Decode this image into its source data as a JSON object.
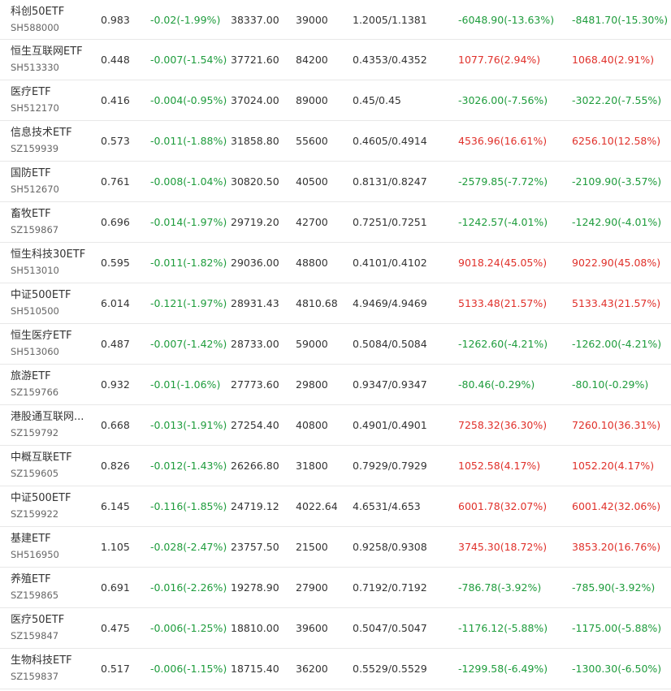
{
  "colors": {
    "up": "#e0302a",
    "down": "#1e9c3c",
    "text": "#333333",
    "subtext": "#666666",
    "divider": "#e8e8e8"
  },
  "rows": [
    {
      "name": "科创50ETF",
      "code": "SH588000",
      "price": "0.983",
      "change": "-0.02(-1.99%)",
      "turnover": "38337.00",
      "volume": "39000",
      "bidask": "1.2005/1.1381",
      "flow1": "-6048.90(-13.63%)",
      "flow1_dir": "down",
      "flow2": "-8481.70(-15.30%)",
      "flow2_dir": "down"
    },
    {
      "name": "恒生互联网ETF",
      "code": "SH513330",
      "price": "0.448",
      "change": "-0.007(-1.54%)",
      "turnover": "37721.60",
      "volume": "84200",
      "bidask": "0.4353/0.4352",
      "flow1": "1077.76(2.94%)",
      "flow1_dir": "up",
      "flow2": "1068.40(2.91%)",
      "flow2_dir": "up"
    },
    {
      "name": "医疗ETF",
      "code": "SH512170",
      "price": "0.416",
      "change": "-0.004(-0.95%)",
      "turnover": "37024.00",
      "volume": "89000",
      "bidask": "0.45/0.45",
      "flow1": "-3026.00(-7.56%)",
      "flow1_dir": "down",
      "flow2": "-3022.20(-7.55%)",
      "flow2_dir": "down"
    },
    {
      "name": "信息技术ETF",
      "code": "SZ159939",
      "price": "0.573",
      "change": "-0.011(-1.88%)",
      "turnover": "31858.80",
      "volume": "55600",
      "bidask": "0.4605/0.4914",
      "flow1": "4536.96(16.61%)",
      "flow1_dir": "up",
      "flow2": "6256.10(12.58%)",
      "flow2_dir": "up"
    },
    {
      "name": "国防ETF",
      "code": "SH512670",
      "price": "0.761",
      "change": "-0.008(-1.04%)",
      "turnover": "30820.50",
      "volume": "40500",
      "bidask": "0.8131/0.8247",
      "flow1": "-2579.85(-7.72%)",
      "flow1_dir": "down",
      "flow2": "-2109.90(-3.57%)",
      "flow2_dir": "down"
    },
    {
      "name": "畜牧ETF",
      "code": "SZ159867",
      "price": "0.696",
      "change": "-0.014(-1.97%)",
      "turnover": "29719.20",
      "volume": "42700",
      "bidask": "0.7251/0.7251",
      "flow1": "-1242.57(-4.01%)",
      "flow1_dir": "down",
      "flow2": "-1242.90(-4.01%)",
      "flow2_dir": "down"
    },
    {
      "name": "恒生科技30ETF",
      "code": "SH513010",
      "price": "0.595",
      "change": "-0.011(-1.82%)",
      "turnover": "29036.00",
      "volume": "48800",
      "bidask": "0.4101/0.4102",
      "flow1": "9018.24(45.05%)",
      "flow1_dir": "up",
      "flow2": "9022.90(45.08%)",
      "flow2_dir": "up"
    },
    {
      "name": "中证500ETF",
      "code": "SH510500",
      "price": "6.014",
      "change": "-0.121(-1.97%)",
      "turnover": "28931.43",
      "volume": "4810.68",
      "bidask": "4.9469/4.9469",
      "flow1": "5133.48(21.57%)",
      "flow1_dir": "up",
      "flow2": "5133.43(21.57%)",
      "flow2_dir": "up"
    },
    {
      "name": "恒生医疗ETF",
      "code": "SH513060",
      "price": "0.487",
      "change": "-0.007(-1.42%)",
      "turnover": "28733.00",
      "volume": "59000",
      "bidask": "0.5084/0.5084",
      "flow1": "-1262.60(-4.21%)",
      "flow1_dir": "down",
      "flow2": "-1262.00(-4.21%)",
      "flow2_dir": "down"
    },
    {
      "name": "旅游ETF",
      "code": "SZ159766",
      "price": "0.932",
      "change": "-0.01(-1.06%)",
      "turnover": "27773.60",
      "volume": "29800",
      "bidask": "0.9347/0.9347",
      "flow1": "-80.46(-0.29%)",
      "flow1_dir": "down",
      "flow2": "-80.10(-0.29%)",
      "flow2_dir": "down"
    },
    {
      "name": "港股通互联网...",
      "code": "SZ159792",
      "price": "0.668",
      "change": "-0.013(-1.91%)",
      "turnover": "27254.40",
      "volume": "40800",
      "bidask": "0.4901/0.4901",
      "flow1": "7258.32(36.30%)",
      "flow1_dir": "up",
      "flow2": "7260.10(36.31%)",
      "flow2_dir": "up"
    },
    {
      "name": "中概互联ETF",
      "code": "SZ159605",
      "price": "0.826",
      "change": "-0.012(-1.43%)",
      "turnover": "26266.80",
      "volume": "31800",
      "bidask": "0.7929/0.7929",
      "flow1": "1052.58(4.17%)",
      "flow1_dir": "up",
      "flow2": "1052.20(4.17%)",
      "flow2_dir": "up"
    },
    {
      "name": "中证500ETF",
      "code": "SZ159922",
      "price": "6.145",
      "change": "-0.116(-1.85%)",
      "turnover": "24719.12",
      "volume": "4022.64",
      "bidask": "4.6531/4.653",
      "flow1": "6001.78(32.07%)",
      "flow1_dir": "up",
      "flow2": "6001.42(32.06%)",
      "flow2_dir": "up"
    },
    {
      "name": "基建ETF",
      "code": "SH516950",
      "price": "1.105",
      "change": "-0.028(-2.47%)",
      "turnover": "23757.50",
      "volume": "21500",
      "bidask": "0.9258/0.9308",
      "flow1": "3745.30(18.72%)",
      "flow1_dir": "up",
      "flow2": "3853.20(16.76%)",
      "flow2_dir": "up"
    },
    {
      "name": "养殖ETF",
      "code": "SZ159865",
      "price": "0.691",
      "change": "-0.016(-2.26%)",
      "turnover": "19278.90",
      "volume": "27900",
      "bidask": "0.7192/0.7192",
      "flow1": "-786.78(-3.92%)",
      "flow1_dir": "down",
      "flow2": "-785.90(-3.92%)",
      "flow2_dir": "down"
    },
    {
      "name": "医疗50ETF",
      "code": "SZ159847",
      "price": "0.475",
      "change": "-0.006(-1.25%)",
      "turnover": "18810.00",
      "volume": "39600",
      "bidask": "0.5047/0.5047",
      "flow1": "-1176.12(-5.88%)",
      "flow1_dir": "down",
      "flow2": "-1175.00(-5.88%)",
      "flow2_dir": "down"
    },
    {
      "name": "生物科技ETF",
      "code": "SZ159837",
      "price": "0.517",
      "change": "-0.006(-1.15%)",
      "turnover": "18715.40",
      "volume": "36200",
      "bidask": "0.5529/0.5529",
      "flow1": "-1299.58(-6.49%)",
      "flow1_dir": "down",
      "flow2": "-1300.30(-6.50%)",
      "flow2_dir": "down"
    }
  ]
}
